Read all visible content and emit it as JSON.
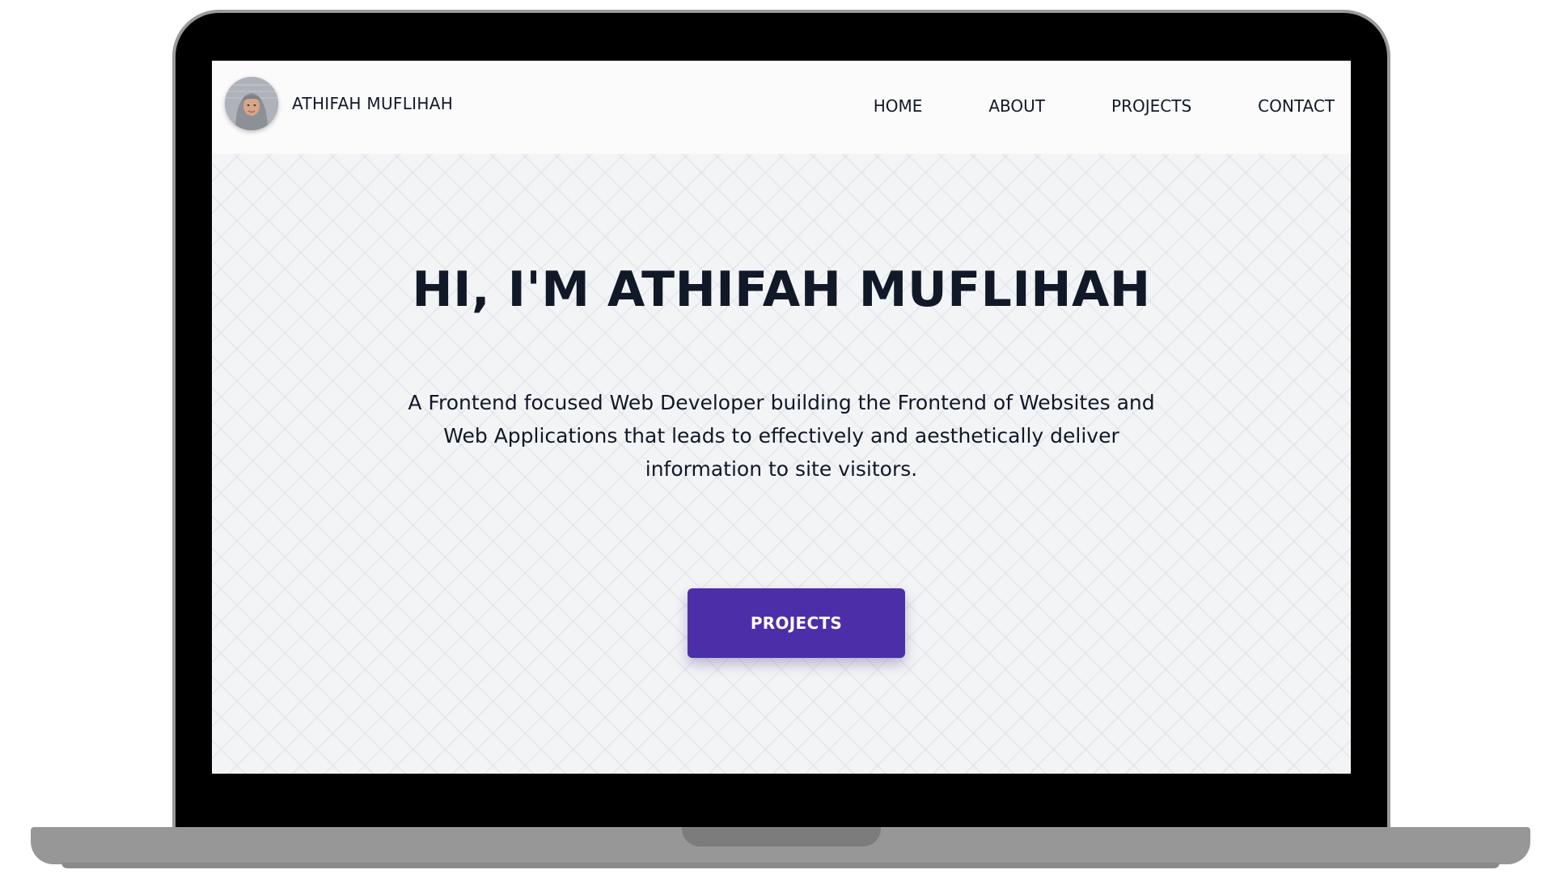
{
  "navbar": {
    "brand_name": "ATHIFAH MUFLIHAH",
    "links": [
      {
        "label": "HOME"
      },
      {
        "label": "ABOUT"
      },
      {
        "label": "PROJECTS"
      },
      {
        "label": "CONTACT"
      }
    ]
  },
  "hero": {
    "title": "HI, I'M ATHIFAH MUFLIHAH",
    "description": "A Frontend focused Web Developer building the Frontend of Websites and Web Applications that leads to effectively and aesthetically deliver information to site visitors.",
    "cta_label": "PROJECTS"
  },
  "colors": {
    "accent": "#4c2fa8",
    "text": "#111827",
    "background": "#f3f4f6",
    "navbar_background": "#fbfbfc",
    "device_frame": "#000000"
  },
  "icons": {
    "avatar": "profile-photo"
  }
}
